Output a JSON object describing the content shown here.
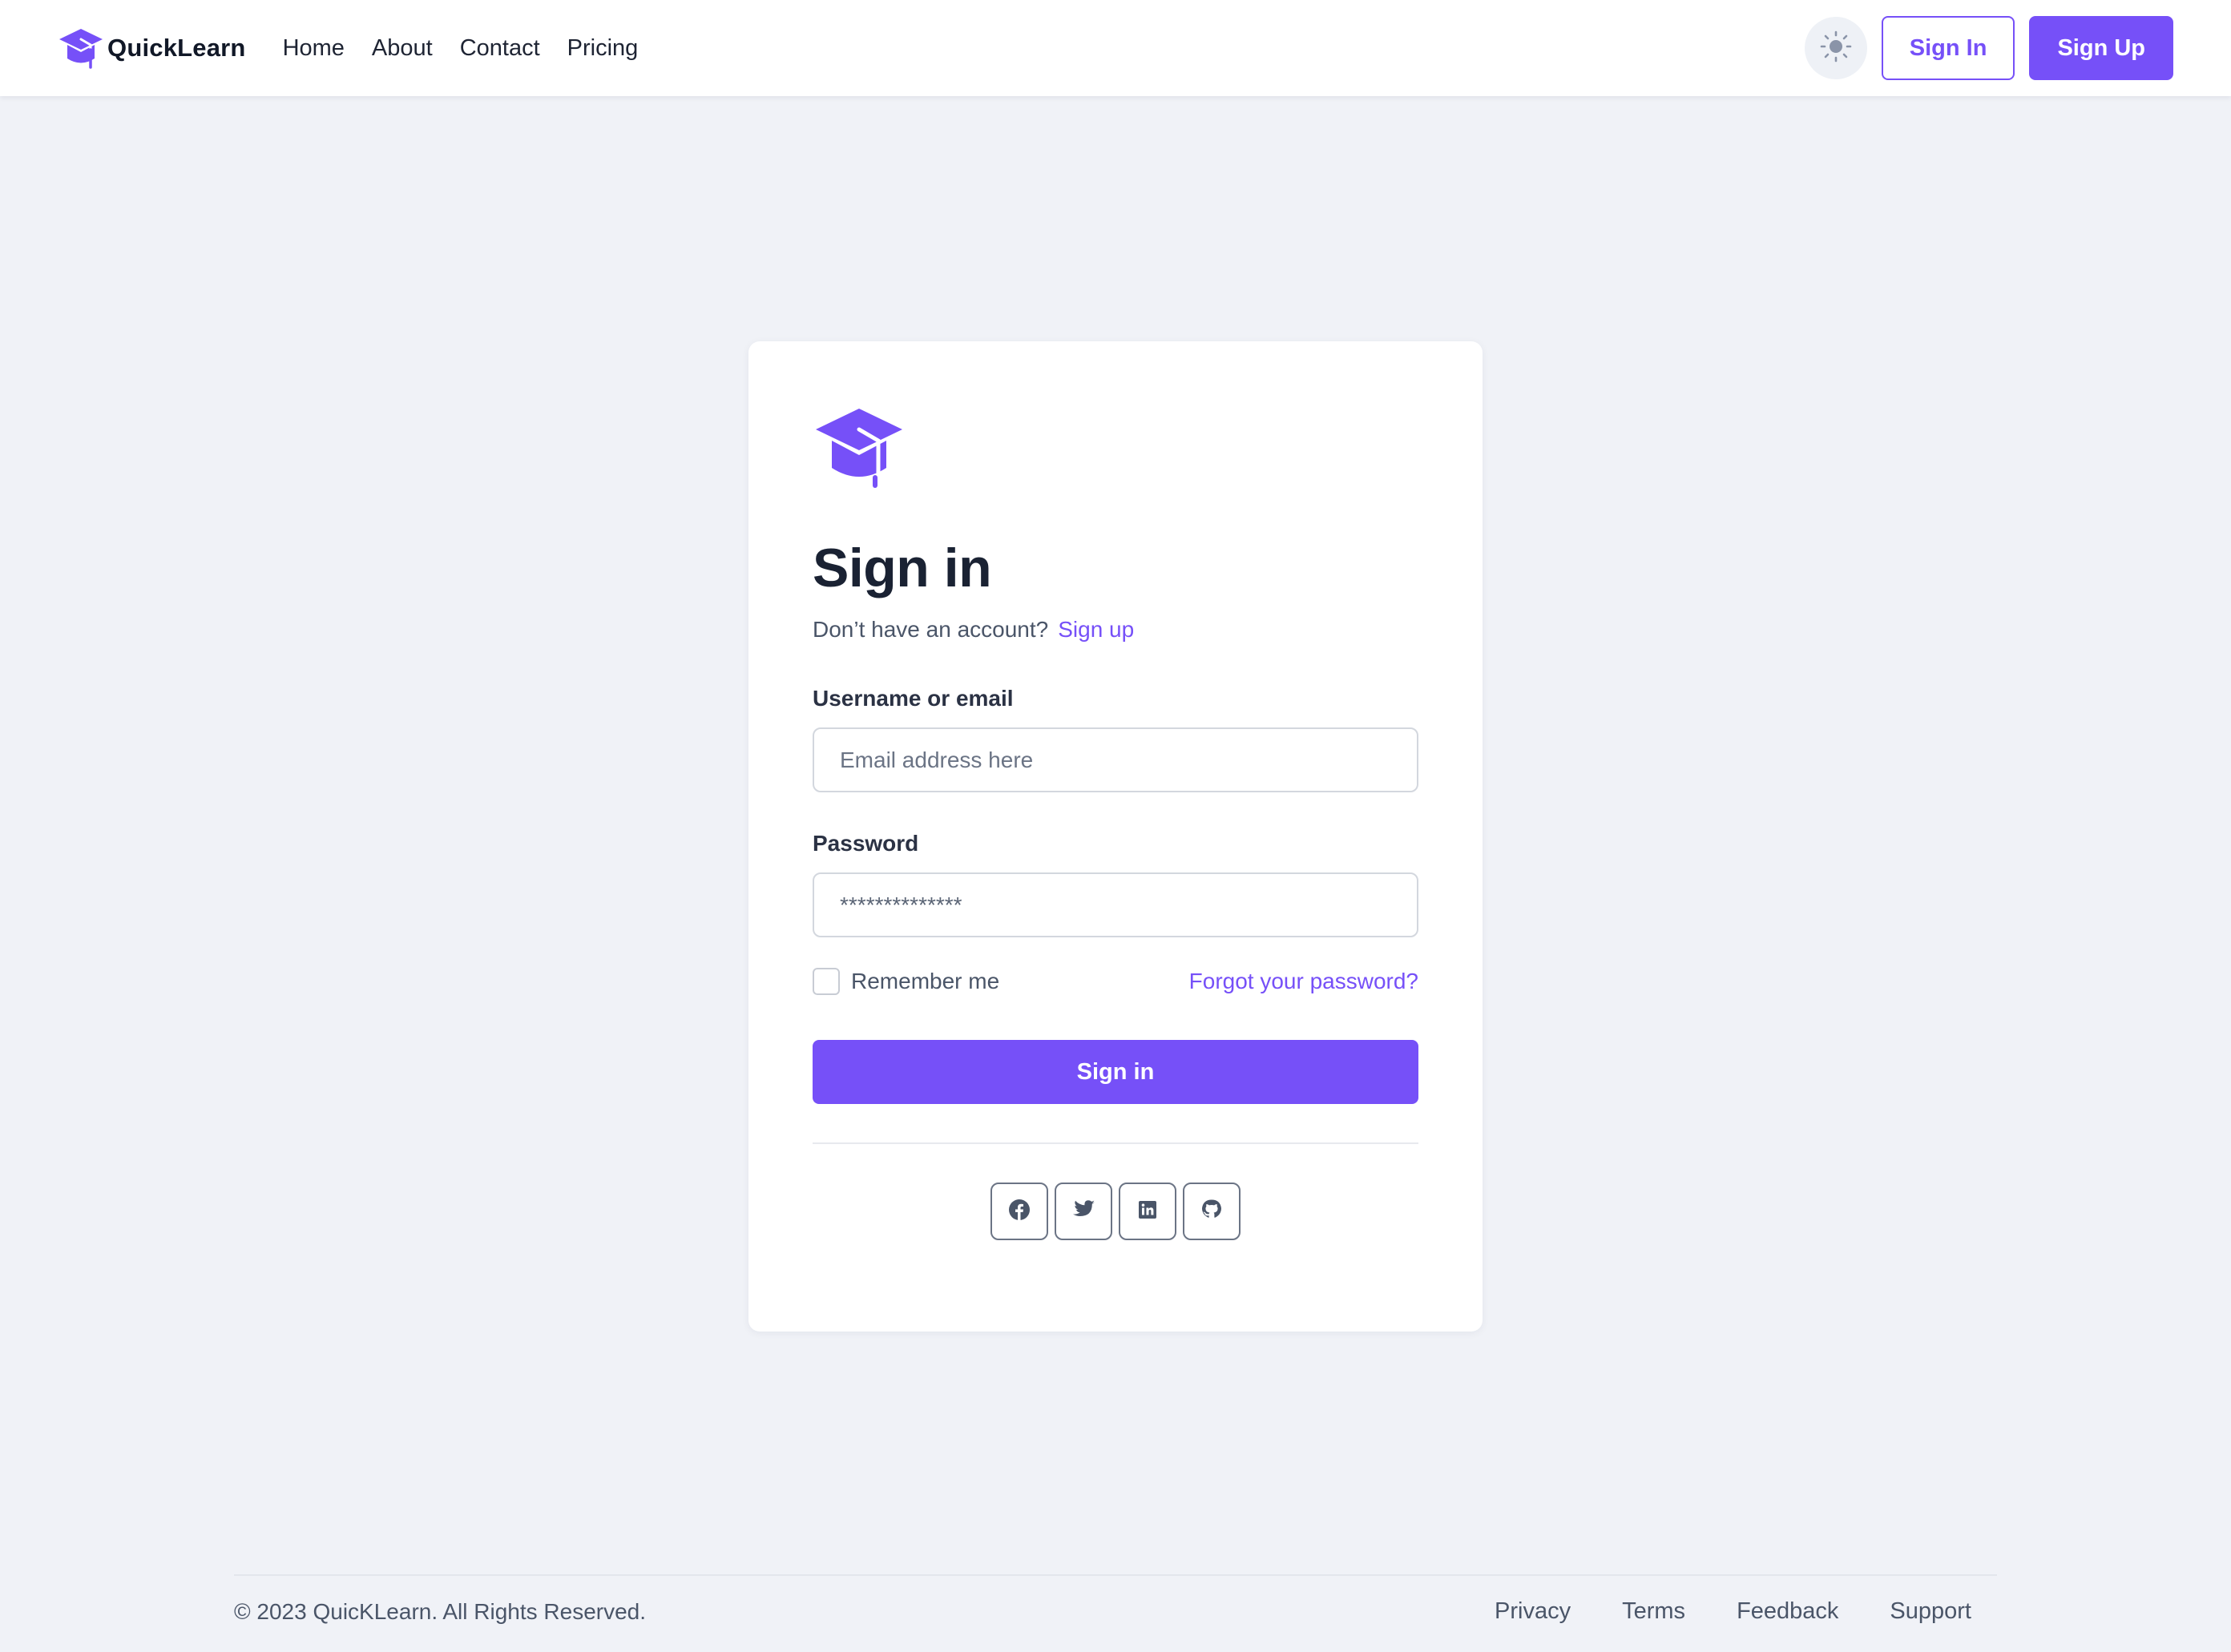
{
  "header": {
    "brand": "QuickLearn",
    "nav": [
      "Home",
      "About",
      "Contact",
      "Pricing"
    ],
    "signin_label": "Sign In",
    "signup_label": "Sign Up"
  },
  "card": {
    "title": "Sign in",
    "prompt": "Don’t have an account?",
    "signup_link": "Sign up",
    "username_label": "Username or email",
    "username_placeholder": "Email address here",
    "password_label": "Password",
    "password_value": "**************",
    "remember_label": "Remember me",
    "forgot_label": "Forgot your password?",
    "submit_label": "Sign in",
    "socials": [
      "facebook-icon",
      "twitter-icon",
      "linkedin-icon",
      "github-icon"
    ]
  },
  "footer": {
    "copyright": "© 2023 QuicKLearn. All Rights Reserved.",
    "links": [
      "Privacy",
      "Terms",
      "Feedback",
      "Support"
    ]
  },
  "colors": {
    "accent": "#7650f8",
    "background": "#f0f2f7",
    "text": "#1e2433"
  }
}
